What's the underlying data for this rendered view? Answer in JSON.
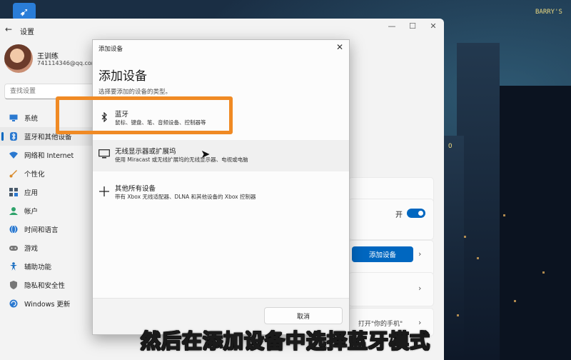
{
  "desktop": {
    "neon_signs": [
      "BARRY'S",
      "O"
    ]
  },
  "settings": {
    "title": "设置",
    "user": {
      "name": "王训练",
      "email": "741114346@qq.com"
    },
    "search": {
      "placeholder": "查找设置"
    },
    "nav": [
      {
        "label": "系统",
        "icon": "monitor-icon",
        "color": "#2b79d0"
      },
      {
        "label": "蓝牙和其他设备",
        "icon": "bluetooth-icon",
        "color": "#2b79d0",
        "active": true
      },
      {
        "label": "网络和 Internet",
        "icon": "wifi-icon",
        "color": "#2b79d0"
      },
      {
        "label": "个性化",
        "icon": "brush-icon",
        "color": "#d98a2b"
      },
      {
        "label": "应用",
        "icon": "apps-icon",
        "color": "#4a5a6a"
      },
      {
        "label": "帐户",
        "icon": "account-icon",
        "color": "#2fa36b"
      },
      {
        "label": "时间和语言",
        "icon": "globe-icon",
        "color": "#2b79d0"
      },
      {
        "label": "游戏",
        "icon": "gamepad-icon",
        "color": "#666"
      },
      {
        "label": "辅助功能",
        "icon": "accessibility-icon",
        "color": "#1b6fc2"
      },
      {
        "label": "隐私和安全性",
        "icon": "shield-icon",
        "color": "#666"
      },
      {
        "label": "Windows 更新",
        "icon": "update-icon",
        "color": "#2b79d0"
      }
    ],
    "toggle_label": "开",
    "add_device_button": "添加设备",
    "phone_button": "打开\"你的手机\""
  },
  "dialog": {
    "window_title": "添加设备",
    "heading": "添加设备",
    "subheading": "选择要添加的设备的类型。",
    "options": [
      {
        "title": "蓝牙",
        "desc": "鼠标、键盘、笔、音频设备、控制器等",
        "icon": "bluetooth-icon"
      },
      {
        "title": "无线显示器或扩展坞",
        "desc": "使用 Miracast 或无线扩展坞的无线显示器、电视或电脑",
        "icon": "monitor-icon"
      },
      {
        "title": "其他所有设备",
        "desc": "带有 Xbox 无线适配器、DLNA 和其他设备的 Xbox 控制器",
        "icon": "plus-icon"
      }
    ],
    "cancel_button": "取消"
  },
  "caption": "然后在添加设备中选择蓝牙模式",
  "accent_colors": {
    "primary": "#0067c0",
    "highlight": "#f08a24"
  }
}
